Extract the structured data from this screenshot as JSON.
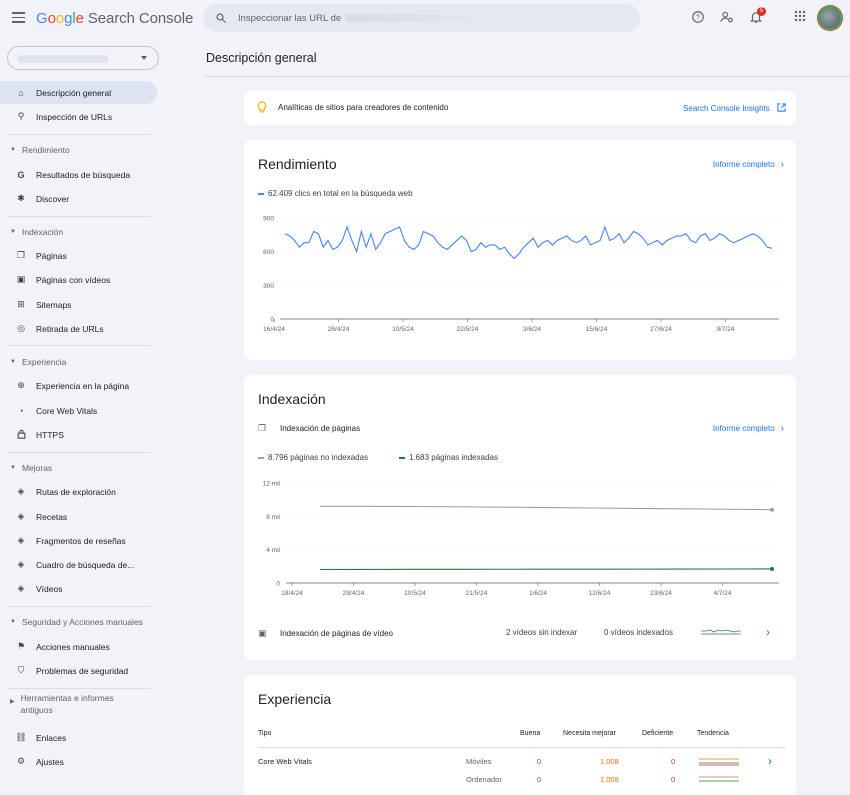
{
  "app": {
    "title_parts": [
      "G",
      "o",
      "o",
      "g",
      "l",
      "e"
    ],
    "product": "Search Console",
    "search_placeholder": "Inspeccionar las URL de",
    "notification_count": "5"
  },
  "sidebar": {
    "items": [
      {
        "label": "Descripción general",
        "icon": "home-icon",
        "glyph": "⌂"
      },
      {
        "label": "Inspección de URLs",
        "icon": "search-icon",
        "glyph": "⚲"
      },
      {
        "label": "Resultados de búsqueda",
        "icon": "google-g-icon",
        "glyph": "G"
      },
      {
        "label": "Discover",
        "icon": "asterisk-icon",
        "glyph": "✱"
      },
      {
        "label": "Páginas",
        "icon": "pages-icon",
        "glyph": "❐"
      },
      {
        "label": "Páginas con vídeos",
        "icon": "video-page-icon",
        "glyph": "▣"
      },
      {
        "label": "Sitemaps",
        "icon": "sitemap-icon",
        "glyph": "⊞"
      },
      {
        "label": "Retirada de URLs",
        "icon": "visibility-off-icon",
        "glyph": "◎"
      },
      {
        "label": "Experiencia en la página",
        "icon": "add-circle-icon",
        "glyph": "⊕"
      },
      {
        "label": "Core Web Vitals",
        "icon": "speed-icon",
        "glyph": "◔"
      },
      {
        "label": "HTTPS",
        "icon": "lock-icon",
        "glyph": "🔒"
      },
      {
        "label": "Rutas de exploración",
        "icon": "layers-icon",
        "glyph": "◈"
      },
      {
        "label": "Recetas",
        "icon": "layers-icon",
        "glyph": "◈"
      },
      {
        "label": "Fragmentos de reseñas",
        "icon": "layers-icon",
        "glyph": "◈"
      },
      {
        "label": "Cuadro de búsqueda de...",
        "icon": "layers-icon",
        "glyph": "◈"
      },
      {
        "label": "Vídeos",
        "icon": "layers-icon",
        "glyph": "◈"
      },
      {
        "label": "Acciones manuales",
        "icon": "flag-icon",
        "glyph": "⚑"
      },
      {
        "label": "Problemas de seguridad",
        "icon": "shield-icon",
        "glyph": "⛉"
      },
      {
        "label": "Enlaces",
        "icon": "link-icon",
        "glyph": "⛓"
      },
      {
        "label": "Ajustes",
        "icon": "gear-icon",
        "glyph": "⚙"
      }
    ],
    "sections": {
      "rendimiento": "Rendimiento",
      "indexacion": "Indexación",
      "experiencia": "Experiencia",
      "mejoras": "Mejoras",
      "seguridad": "Seguridad y Acciones manuales",
      "herramientas": "Herramientas e informes antiguos"
    }
  },
  "main": {
    "title": "Descripción general",
    "insights": {
      "text": "Analíticas de sitios para creadores de contenido",
      "link": "Search Console Insights"
    },
    "performance": {
      "title": "Rendimiento",
      "report_link": "Informe completo",
      "legend": "62.409 clics en total en la búsqueda web",
      "color": "#4285f4"
    },
    "indexing": {
      "title": "Indexación",
      "pages_label": "Indexación de páginas",
      "report_link": "Informe completo",
      "legend_not_indexed": "8.796 páginas no indexadas",
      "legend_indexed": "1.683 páginas indexadas",
      "video_label": "Indexación de páginas de vídeo",
      "video_not_indexed": "2 vídeos sin indexar",
      "video_indexed": "0 vídeos indexados",
      "color_not_indexed": "#9aa0a6",
      "color_indexed": "#188038"
    },
    "experience": {
      "title": "Experiencia",
      "columns": [
        "Tipo",
        "Buena",
        "Necesita mejorar",
        "Deficiente",
        "Tendencia"
      ],
      "rows": [
        {
          "type": "Core Web Vitals",
          "device": "Móviles",
          "good": "0",
          "needs": "1.008",
          "poor": "0"
        },
        {
          "type": "",
          "device": "Ordenador",
          "good": "0",
          "needs": "1.008",
          "poor": "0"
        }
      ]
    }
  },
  "chart_data": [
    {
      "type": "line",
      "title": "",
      "series": [
        {
          "name": "62.409 clics en total en la búsqueda web",
          "values": [
            760,
            740,
            700,
            640,
            680,
            680,
            780,
            760,
            640,
            700,
            620,
            640,
            700,
            820,
            700,
            600,
            780,
            640,
            760,
            620,
            680,
            760,
            780,
            800,
            820,
            700,
            640,
            620,
            660,
            780,
            760,
            740,
            680,
            640,
            620,
            660,
            700,
            740,
            700,
            600,
            620,
            680,
            640,
            660,
            660,
            620,
            640,
            580,
            540,
            580,
            640,
            680,
            720,
            640,
            680,
            700,
            660,
            700,
            720,
            740,
            700,
            680,
            700,
            740,
            660,
            680,
            700,
            820,
            700,
            720,
            760,
            680,
            720,
            780,
            760,
            720,
            660,
            680,
            700,
            660,
            700,
            720,
            740,
            740,
            760,
            700,
            680,
            740,
            760,
            700,
            720,
            760,
            740,
            700,
            680,
            700,
            720,
            740,
            760,
            740,
            700,
            640,
            630
          ]
        }
      ],
      "ylim": [
        0,
        900
      ],
      "yticks": [
        "0",
        "300",
        "600",
        "900"
      ],
      "xticks": [
        "16/4/24",
        "28/4/24",
        "10/5/24",
        "22/5/24",
        "3/6/24",
        "15/6/24",
        "27/6/24",
        "9/7/24"
      ]
    },
    {
      "type": "line",
      "title": "",
      "series": [
        {
          "name": "8.796 páginas no indexadas",
          "values": [
            9200,
            9200,
            9180,
            9150,
            9100,
            9050,
            9000,
            8950,
            8900,
            8850,
            8796
          ]
        },
        {
          "name": "1.683 páginas indexadas",
          "values": [
            1620,
            1630,
            1640,
            1645,
            1650,
            1655,
            1660,
            1665,
            1670,
            1680,
            1683
          ]
        }
      ],
      "ylim": [
        0,
        12000
      ],
      "yticks": [
        "0",
        "4 mil",
        "8 mil",
        "12 mil"
      ],
      "xticks": [
        "18/4/24",
        "29/4/24",
        "10/5/24",
        "21/5/24",
        "1/6/24",
        "12/6/24",
        "23/6/24",
        "4/7/24"
      ]
    }
  ]
}
